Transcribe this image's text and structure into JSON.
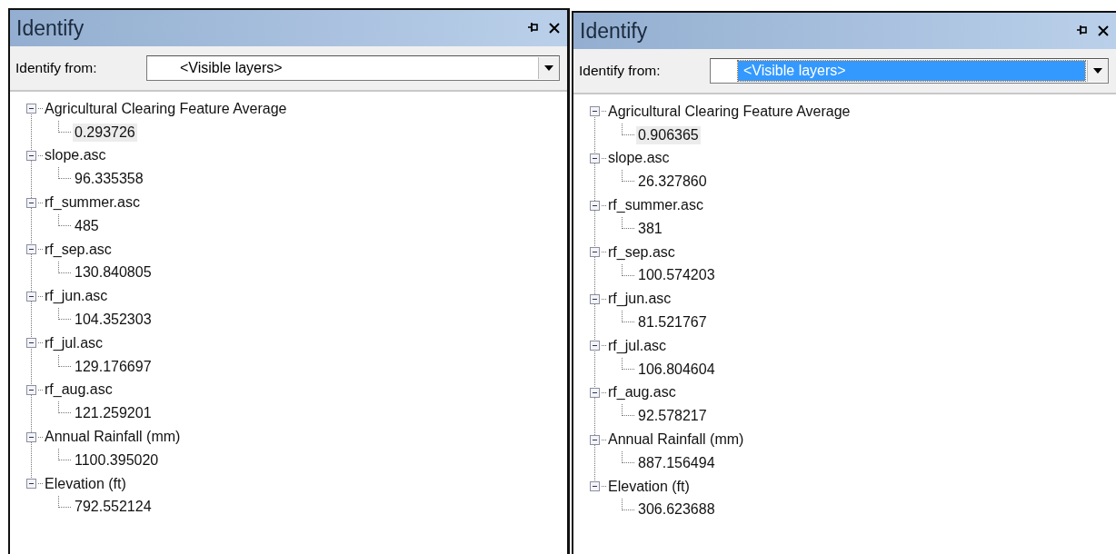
{
  "panels": [
    {
      "title": "Identify",
      "identify_from_label": "Identify from:",
      "dropdown": {
        "value": "<Visible layers>",
        "selected": false
      },
      "tree": [
        {
          "label": "Agricultural Clearing Feature Average",
          "expanded": true,
          "children": [
            {
              "label": "0.293726",
              "selected": true
            }
          ]
        },
        {
          "label": "slope.asc",
          "expanded": true,
          "children": [
            {
              "label": "96.335358",
              "selected": false
            }
          ]
        },
        {
          "label": "rf_summer.asc",
          "expanded": true,
          "children": [
            {
              "label": "485",
              "selected": false
            }
          ]
        },
        {
          "label": "rf_sep.asc",
          "expanded": true,
          "children": [
            {
              "label": "130.840805",
              "selected": false
            }
          ]
        },
        {
          "label": "rf_jun.asc",
          "expanded": true,
          "children": [
            {
              "label": "104.352303",
              "selected": false
            }
          ]
        },
        {
          "label": "rf_jul.asc",
          "expanded": true,
          "children": [
            {
              "label": "129.176697",
              "selected": false
            }
          ]
        },
        {
          "label": "rf_aug.asc",
          "expanded": true,
          "children": [
            {
              "label": "121.259201",
              "selected": false
            }
          ]
        },
        {
          "label": "Annual Rainfall (mm)",
          "expanded": true,
          "children": [
            {
              "label": "1100.395020",
              "selected": false
            }
          ]
        },
        {
          "label": "Elevation (ft)",
          "expanded": true,
          "children": [
            {
              "label": "792.552124",
              "selected": false
            }
          ]
        }
      ]
    },
    {
      "title": "Identify",
      "identify_from_label": "Identify from:",
      "dropdown": {
        "value": "<Visible layers>",
        "selected": true
      },
      "tree": [
        {
          "label": "Agricultural Clearing Feature Average",
          "expanded": true,
          "children": [
            {
              "label": "0.906365",
              "selected": true
            }
          ]
        },
        {
          "label": "slope.asc",
          "expanded": true,
          "children": [
            {
              "label": "26.327860",
              "selected": false
            }
          ]
        },
        {
          "label": "rf_summer.asc",
          "expanded": true,
          "children": [
            {
              "label": "381",
              "selected": false
            }
          ]
        },
        {
          "label": "rf_sep.asc",
          "expanded": true,
          "children": [
            {
              "label": "100.574203",
              "selected": false
            }
          ]
        },
        {
          "label": "rf_jun.asc",
          "expanded": true,
          "children": [
            {
              "label": "81.521767",
              "selected": false
            }
          ]
        },
        {
          "label": "rf_jul.asc",
          "expanded": true,
          "children": [
            {
              "label": "106.804604",
              "selected": false
            }
          ]
        },
        {
          "label": "rf_aug.asc",
          "expanded": true,
          "children": [
            {
              "label": "92.578217",
              "selected": false
            }
          ]
        },
        {
          "label": "Annual Rainfall (mm)",
          "expanded": true,
          "children": [
            {
              "label": "887.156494",
              "selected": false
            }
          ]
        },
        {
          "label": "Elevation (ft)",
          "expanded": true,
          "children": [
            {
              "label": "306.623688",
              "selected": false
            }
          ]
        }
      ]
    }
  ]
}
